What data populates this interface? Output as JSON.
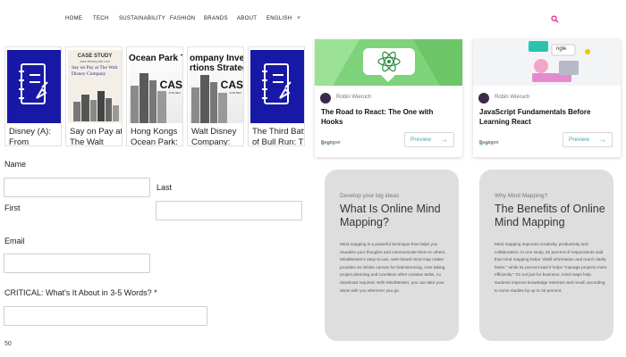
{
  "nav": {
    "items": [
      "HOME",
      "TECH",
      "SUSTAINABILITY",
      "FASHION",
      "BRANDS",
      "ABOUT",
      "ENGLISH"
    ],
    "language_chevron": "˅",
    "search_icon": "search-icon",
    "accent": "#e11fa0"
  },
  "books": [
    {
      "title": "Disney (A):",
      "title2": "From",
      "cover": "blue"
    },
    {
      "title": "Say on Pay at",
      "title2": "The Walt",
      "cover": "cream",
      "cover_site": "CASE STUDY",
      "cover_sub": "www.dummy.site.com",
      "cover_caption": "Say on Pay at The Walt Disney Company"
    },
    {
      "title": "Hong Kongs",
      "title2": "Ocean Park:",
      "cover": "photo",
      "cover_caption": "Ocean Park Tal",
      "cover_mark": "CAS",
      "cover_mark_sub": "FOR REV"
    },
    {
      "title": "Walt Disney",
      "title2": "Company:",
      "cover": "photo",
      "cover_caption": "ompany Inves\nrtions Strategy",
      "cover_mark": "CAS",
      "cover_mark_sub": "FOR REV"
    },
    {
      "title": "The Third Battle",
      "title2": "of Bull Run: The",
      "cover": "blue"
    }
  ],
  "form": {
    "name_label": "Name",
    "first_label": "First",
    "last_label": "Last",
    "email_label": "Email",
    "critical_label": "CRITICAL: What's It About in 3-5 Words? *",
    "counter": "50"
  },
  "courses": [
    {
      "author": "Robin Wieruch",
      "title": "The Road to React: The One with Hooks",
      "level": "Beginner",
      "preview": "Preview",
      "banner_color": "#7ed37a"
    },
    {
      "author": "Robin Wieruch",
      "title": "JavaScript Fundamentals Before Learning React",
      "level": "Beginner",
      "preview": "Preview",
      "banner_color": "#f3f4f6",
      "banner_tag": "ngle"
    }
  ],
  "mindmap": [
    {
      "kicker": "Develop your big ideas",
      "heading": "What Is Online Mind Mapping?",
      "body": "Mind mapping is a powerful technique that helps you visualize your thoughts and communicate them to others. MindMeister's easy-to-use, web-based mind map maker provides an infinite canvas for brainstorming, note taking, project planning and countless other creative tasks, no download required. With MindMeister, you can take your ideas with you wherever you go."
    },
    {
      "kicker": "Why Mind Mapping?",
      "heading": "The Benefits of Online Mind Mapping",
      "body": "Mind mapping improves creativity, productivity and collaboration. In one study, 92 percent of respondents said that mind mapping helps \"distill information and reach clarity faster,\" while 81 percent said it helps \"manage projects more efficiently.\" It's not just for business: mind maps help students improve knowledge retention and recall, according to some studies by up to 32 percent."
    }
  ]
}
